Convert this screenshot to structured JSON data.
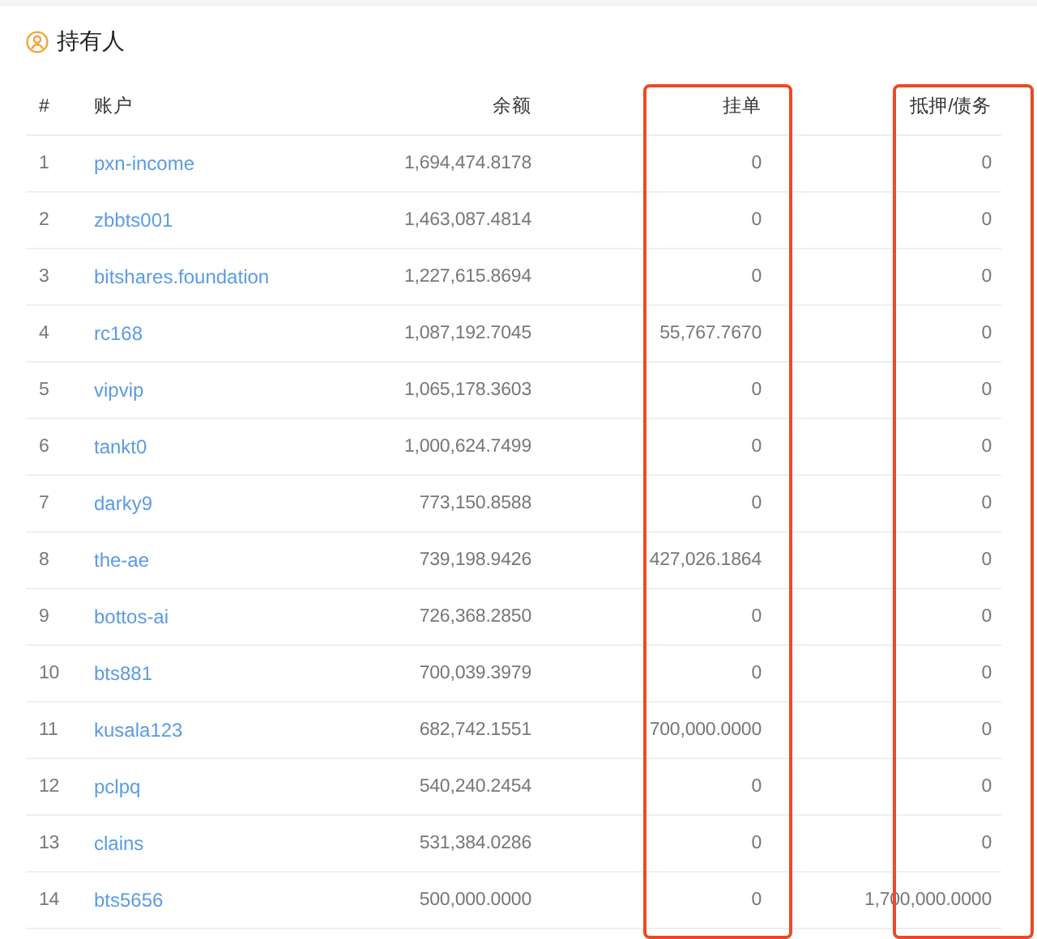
{
  "section": {
    "title": "持有人"
  },
  "columns": [
    {
      "label": "#",
      "highlighted": false
    },
    {
      "label": "账户",
      "highlighted": false
    },
    {
      "label": "余额",
      "highlighted": false
    },
    {
      "label": "挂单",
      "highlighted": true
    },
    {
      "label": "抵押/债务",
      "highlighted": true
    }
  ],
  "rows": [
    {
      "rank": "1",
      "account": "pxn-income",
      "balance": "1,694,474.8178",
      "orders": "0",
      "collateral": "0"
    },
    {
      "rank": "2",
      "account": "zbbts001",
      "balance": "1,463,087.4814",
      "orders": "0",
      "collateral": "0"
    },
    {
      "rank": "3",
      "account": "bitshares.foundation",
      "balance": "1,227,615.8694",
      "orders": "0",
      "collateral": "0"
    },
    {
      "rank": "4",
      "account": "rc168",
      "balance": "1,087,192.7045",
      "orders": "55,767.7670",
      "collateral": "0"
    },
    {
      "rank": "5",
      "account": "vipvip",
      "balance": "1,065,178.3603",
      "orders": "0",
      "collateral": "0"
    },
    {
      "rank": "6",
      "account": "tankt0",
      "balance": "1,000,624.7499",
      "orders": "0",
      "collateral": "0"
    },
    {
      "rank": "7",
      "account": "darky9",
      "balance": "773,150.8588",
      "orders": "0",
      "collateral": "0"
    },
    {
      "rank": "8",
      "account": "the-ae",
      "balance": "739,198.9426",
      "orders": "427,026.1864",
      "collateral": "0"
    },
    {
      "rank": "9",
      "account": "bottos-ai",
      "balance": "726,368.2850",
      "orders": "0",
      "collateral": "0"
    },
    {
      "rank": "10",
      "account": "bts881",
      "balance": "700,039.3979",
      "orders": "0",
      "collateral": "0"
    },
    {
      "rank": "11",
      "account": "kusala123",
      "balance": "682,742.1551",
      "orders": "700,000.0000",
      "collateral": "0"
    },
    {
      "rank": "12",
      "account": "pclpq",
      "balance": "540,240.2454",
      "orders": "0",
      "collateral": "0"
    },
    {
      "rank": "13",
      "account": "clains",
      "balance": "531,384.0286",
      "orders": "0",
      "collateral": "0"
    },
    {
      "rank": "14",
      "account": "bts5656",
      "balance": "500,000.0000",
      "orders": "0",
      "collateral": "1,700,000.0000"
    }
  ]
}
